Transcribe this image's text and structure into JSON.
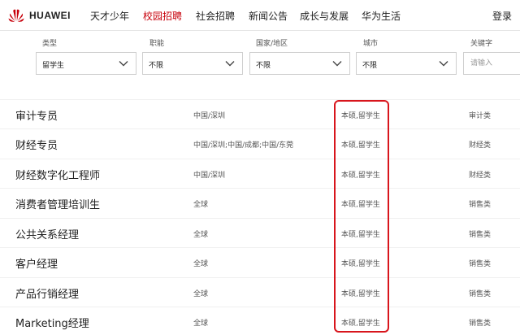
{
  "brand": {
    "name": "HUAWEI",
    "color": "#c7000b"
  },
  "nav": {
    "items": [
      {
        "label": "天才少年",
        "active": false
      },
      {
        "label": "校园招聘",
        "active": true
      },
      {
        "label": "社会招聘",
        "active": false
      },
      {
        "label": "新闻公告",
        "active": false
      },
      {
        "label": "成长与发展",
        "active": false
      },
      {
        "label": "华为生活",
        "active": false
      }
    ],
    "login_label": "登录"
  },
  "filters": {
    "type": {
      "label": "类型",
      "value": "留学生"
    },
    "function": {
      "label": "职能",
      "value": "不限"
    },
    "country": {
      "label": "国家/地区",
      "value": "不限"
    },
    "city": {
      "label": "城市",
      "value": "不限"
    },
    "keyword": {
      "label": "关键字",
      "placeholder": "请输入"
    }
  },
  "jobs": [
    {
      "title": "审计专员",
      "location": "中国/深圳",
      "degree": "本硕,留学生",
      "category": "审计类"
    },
    {
      "title": "财经专员",
      "location": "中国/深圳;中国/成都;中国/东莞",
      "degree": "本硕,留学生",
      "category": "财经类"
    },
    {
      "title": "财经数字化工程师",
      "location": "中国/深圳",
      "degree": "本硕,留学生",
      "category": "财经类"
    },
    {
      "title": "消费者管理培训生",
      "location": "全球",
      "degree": "本硕,留学生",
      "category": "销售类"
    },
    {
      "title": "公共关系经理",
      "location": "全球",
      "degree": "本硕,留学生",
      "category": "销售类"
    },
    {
      "title": "客户经理",
      "location": "全球",
      "degree": "本硕,留学生",
      "category": "销售类"
    },
    {
      "title": "产品行销经理",
      "location": "全球",
      "degree": "本硕,留学生",
      "category": "销售类"
    },
    {
      "title": "Marketing经理",
      "location": "全球",
      "degree": "本硕,留学生",
      "category": "销售类"
    }
  ],
  "highlight_color": "#d8151c"
}
